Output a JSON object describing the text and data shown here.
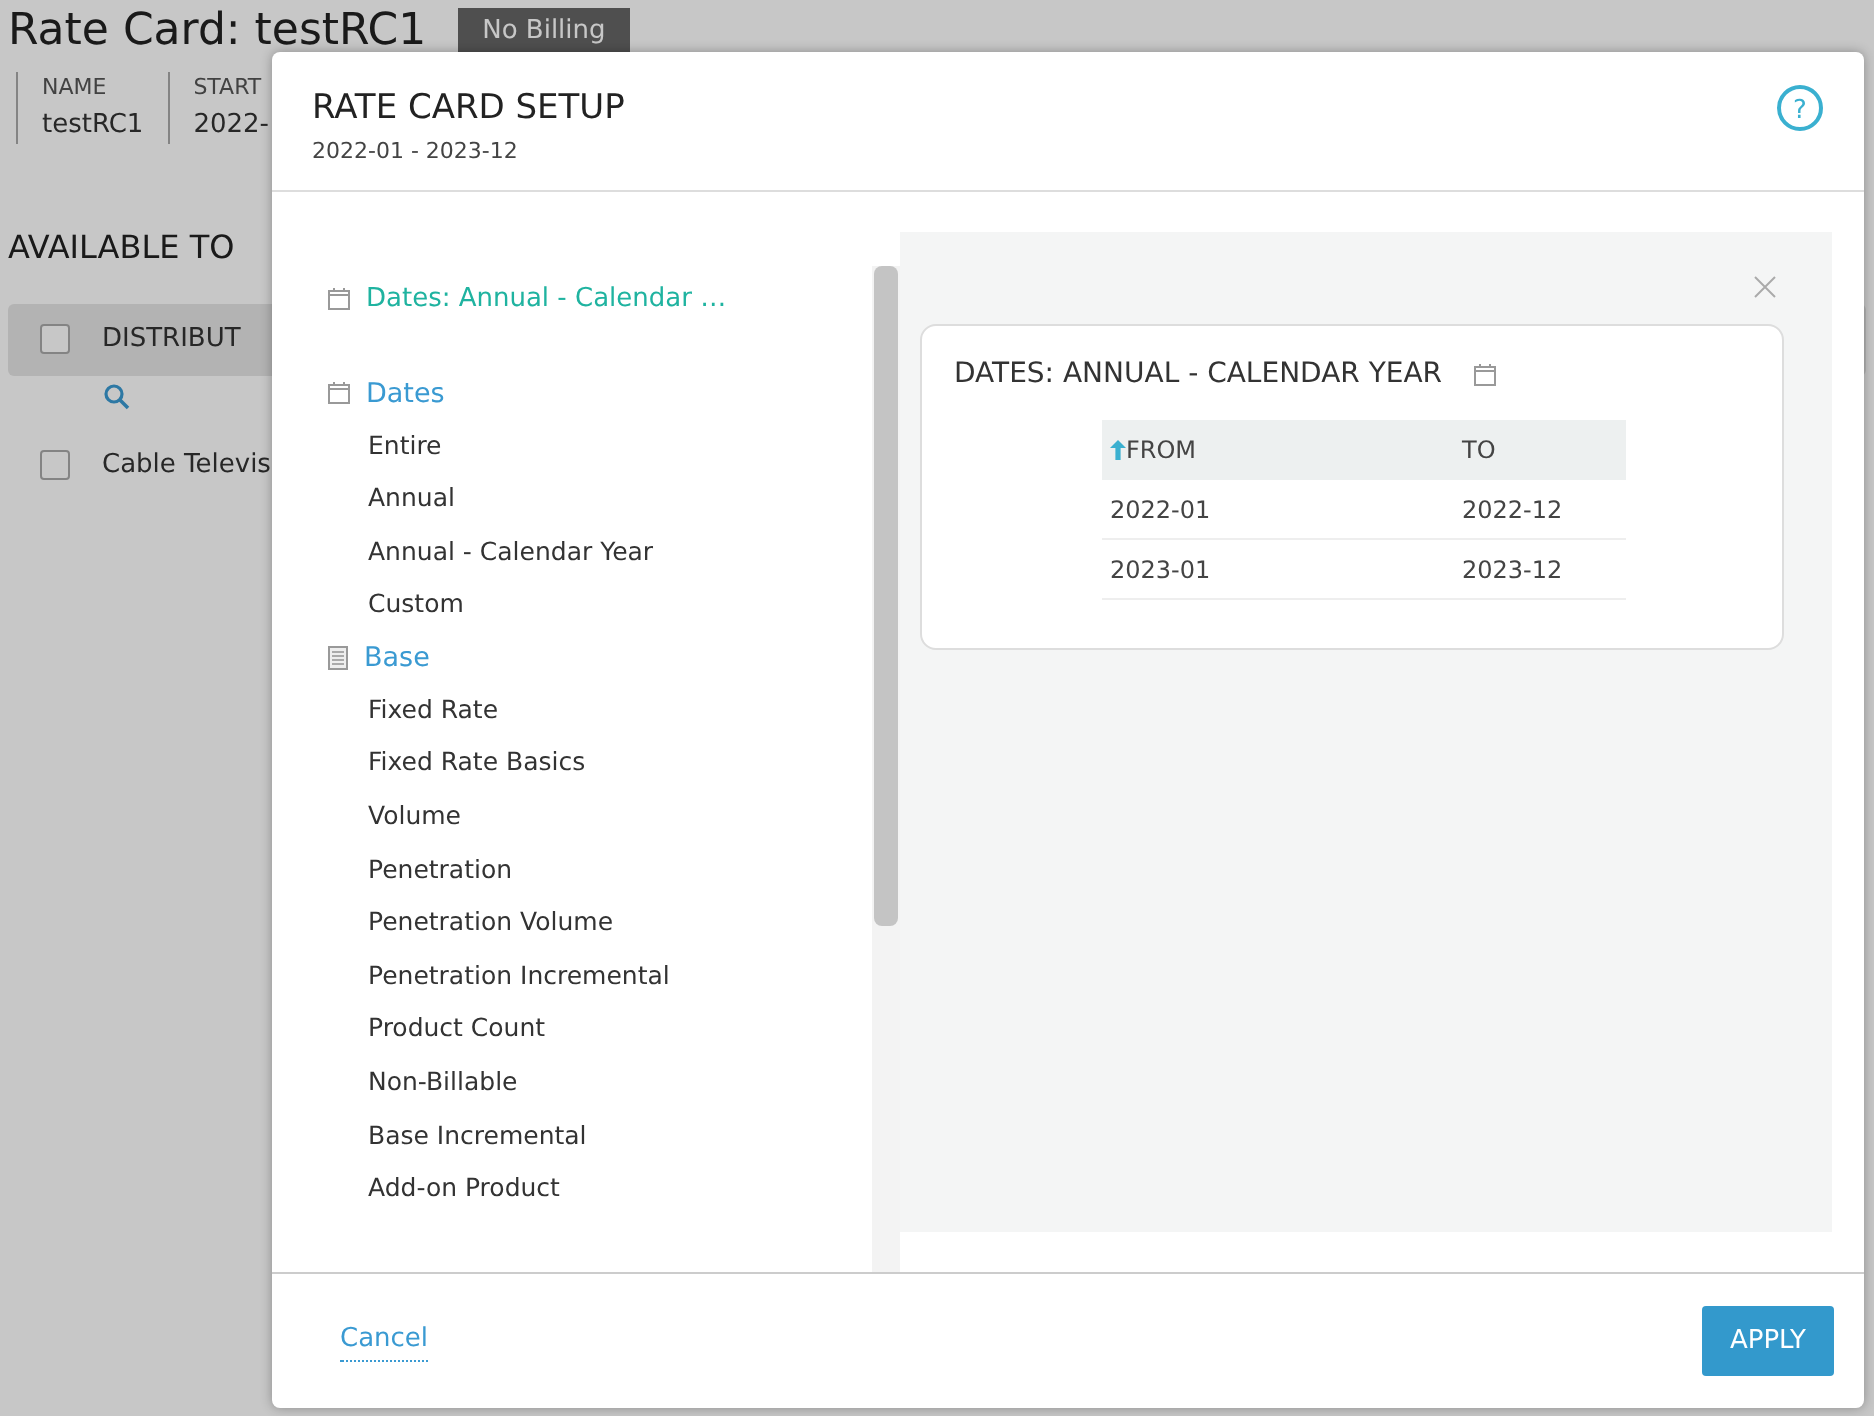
{
  "page": {
    "title": "Rate Card: testRC1",
    "badge": "No Billing",
    "info": [
      {
        "label": "NAME",
        "value": "testRC1"
      },
      {
        "label": "START",
        "value": "2022-"
      }
    ],
    "section_title": "AVAILABLE TO",
    "table": {
      "header_checked": false,
      "columns": [
        "DISTRIBUT"
      ],
      "rows": [
        {
          "checked": false,
          "cells": [
            "Cable Televis"
          ]
        }
      ]
    }
  },
  "modal": {
    "help": "?",
    "title": "RATE CARD SETUP",
    "subtitle": "2022-01 - 2023-12",
    "selected_summary": "Dates: Annual - Calendar …",
    "groups": [
      {
        "kind": "dates",
        "label": "Dates",
        "items": [
          "Entire",
          "Annual",
          "Annual - Calendar Year",
          "Custom"
        ]
      },
      {
        "kind": "base",
        "label": "Base",
        "items": [
          "Fixed Rate",
          "Fixed Rate Basics",
          "Volume",
          "Penetration",
          "Penetration Volume",
          "Penetration Incremental",
          "Product Count",
          "Non-Billable",
          "Base Incremental",
          "Add-on Product"
        ]
      }
    ],
    "detail": {
      "title": "DATES: ANNUAL - CALENDAR YEAR",
      "columns": [
        "FROM",
        "TO"
      ],
      "rows": [
        [
          "2022-01",
          "2022-12"
        ],
        [
          "2023-01",
          "2023-12"
        ]
      ]
    },
    "cancel": "Cancel",
    "apply": "APPLY"
  }
}
